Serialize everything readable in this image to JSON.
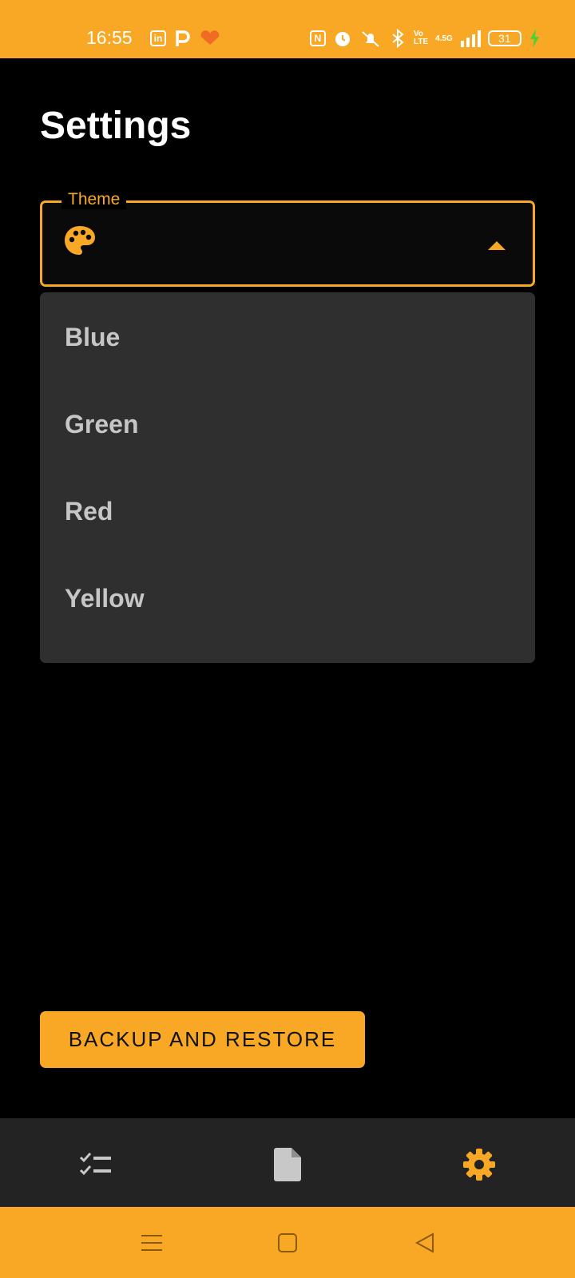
{
  "status_bar": {
    "time": "16:55",
    "network_label": "4.5G",
    "battery": "31",
    "background_color": "#f8a824"
  },
  "page": {
    "title": "Settings"
  },
  "theme_select": {
    "label": "Theme",
    "icon": "palette-icon",
    "expanded": true,
    "options": [
      "Blue",
      "Green",
      "Red",
      "Yellow"
    ]
  },
  "actions": {
    "backup_label": "BACKUP AND RESTORE"
  },
  "bottom_nav": {
    "items": [
      {
        "icon": "checklist-icon",
        "active": false
      },
      {
        "icon": "document-icon",
        "active": false
      },
      {
        "icon": "gear-icon",
        "active": true
      }
    ]
  },
  "system_nav": {
    "items": [
      "menu-icon",
      "home-icon",
      "back-icon"
    ]
  },
  "colors": {
    "accent": "#f8a824",
    "background": "#000000",
    "menu_background": "#2f2f2f",
    "nav_background": "#232323"
  }
}
